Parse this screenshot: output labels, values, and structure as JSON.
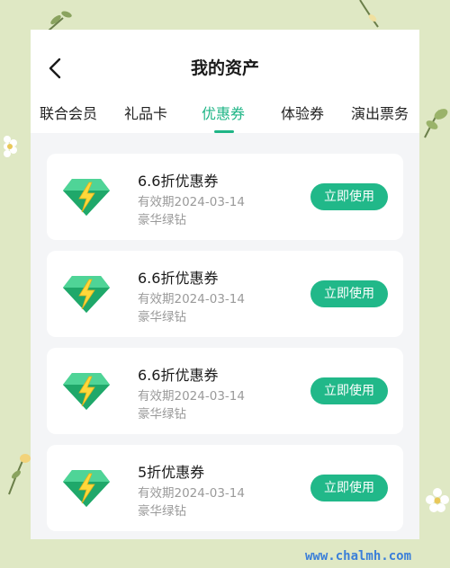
{
  "header": {
    "title": "我的资产"
  },
  "tabs": [
    {
      "label": "联合会员",
      "active": false
    },
    {
      "label": "礼品卡",
      "active": false
    },
    {
      "label": "优惠券",
      "active": true
    },
    {
      "label": "体验券",
      "active": false
    },
    {
      "label": "演出票务",
      "active": false
    }
  ],
  "coupons": [
    {
      "name": "6.6折优惠券",
      "expiry": "有效期2024-03-14",
      "type": "豪华绿钻",
      "button": "立即使用"
    },
    {
      "name": "6.6折优惠券",
      "expiry": "有效期2024-03-14",
      "type": "豪华绿钻",
      "button": "立即使用"
    },
    {
      "name": "6.6折优惠券",
      "expiry": "有效期2024-03-14",
      "type": "豪华绿钻",
      "button": "立即使用"
    },
    {
      "name": "5折优惠券",
      "expiry": "有效期2024-03-14",
      "type": "豪华绿钻",
      "button": "立即使用"
    }
  ],
  "icons": {
    "back": "chevron-left-icon",
    "coupon": "green-diamond-lightning-icon"
  },
  "colors": {
    "accent": "#1fb586",
    "button": "#21b889",
    "background": "#dfe8c4"
  },
  "watermark": "www.chalmh.com"
}
